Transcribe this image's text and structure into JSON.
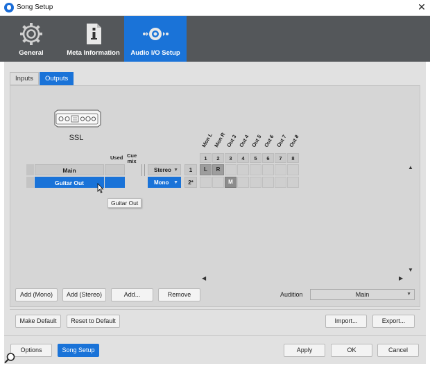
{
  "window": {
    "title": "Song Setup",
    "close_glyph": "✕"
  },
  "header_tabs": [
    {
      "label": "General",
      "icon": "gear-icon",
      "active": false
    },
    {
      "label": "Meta Information",
      "icon": "info-document-icon",
      "active": false
    },
    {
      "label": "Audio I/O Setup",
      "icon": "audio-io-icon",
      "active": true
    }
  ],
  "sub_tabs": [
    {
      "label": "Inputs",
      "active": false
    },
    {
      "label": "Outputs",
      "active": true
    }
  ],
  "device": {
    "name": "SSL",
    "icon": "audio-interface-icon"
  },
  "columns": {
    "used": "Used",
    "cue_mix_line1": "Cue",
    "cue_mix_line2": "mix"
  },
  "channels": [
    {
      "name": "Main",
      "format": "Stereo",
      "number": "1",
      "selected": false
    },
    {
      "name": "Guitar Out",
      "format": "Mono",
      "number": "2*",
      "selected": true
    }
  ],
  "outputs": {
    "labels": [
      "Mon L",
      "Mon R",
      "Out 3",
      "Out 4",
      "Out 5",
      "Out 6",
      "Out 7",
      "Out 8"
    ],
    "numbers": [
      "1",
      "2",
      "3",
      "4",
      "5",
      "6",
      "7",
      "8"
    ],
    "row1_assign": [
      "L",
      "R",
      "",
      "",
      "",
      "",
      "",
      ""
    ],
    "row2_assign": [
      "",
      "",
      "M",
      "",
      "",
      "",
      "",
      ""
    ]
  },
  "tooltip": "Guitar Out",
  "scroll_glyphs": {
    "up": "▲",
    "down": "▼",
    "left": "◀",
    "right": "▶",
    "dropdown": "▼"
  },
  "buttons": {
    "add_mono": "Add (Mono)",
    "add_stereo": "Add (Stereo)",
    "add": "Add...",
    "remove": "Remove",
    "make_default": "Make Default",
    "reset_default": "Reset to Default",
    "import": "Import...",
    "export": "Export...",
    "options": "Options",
    "song_setup": "Song Setup",
    "apply": "Apply",
    "ok": "OK",
    "cancel": "Cancel"
  },
  "audition": {
    "label": "Audition",
    "value": "Main"
  },
  "colors": {
    "accent": "#1a73d8",
    "header_bg": "#54575a",
    "panel_bg": "#e1e1e1",
    "content_bg": "#d6d6d6"
  }
}
